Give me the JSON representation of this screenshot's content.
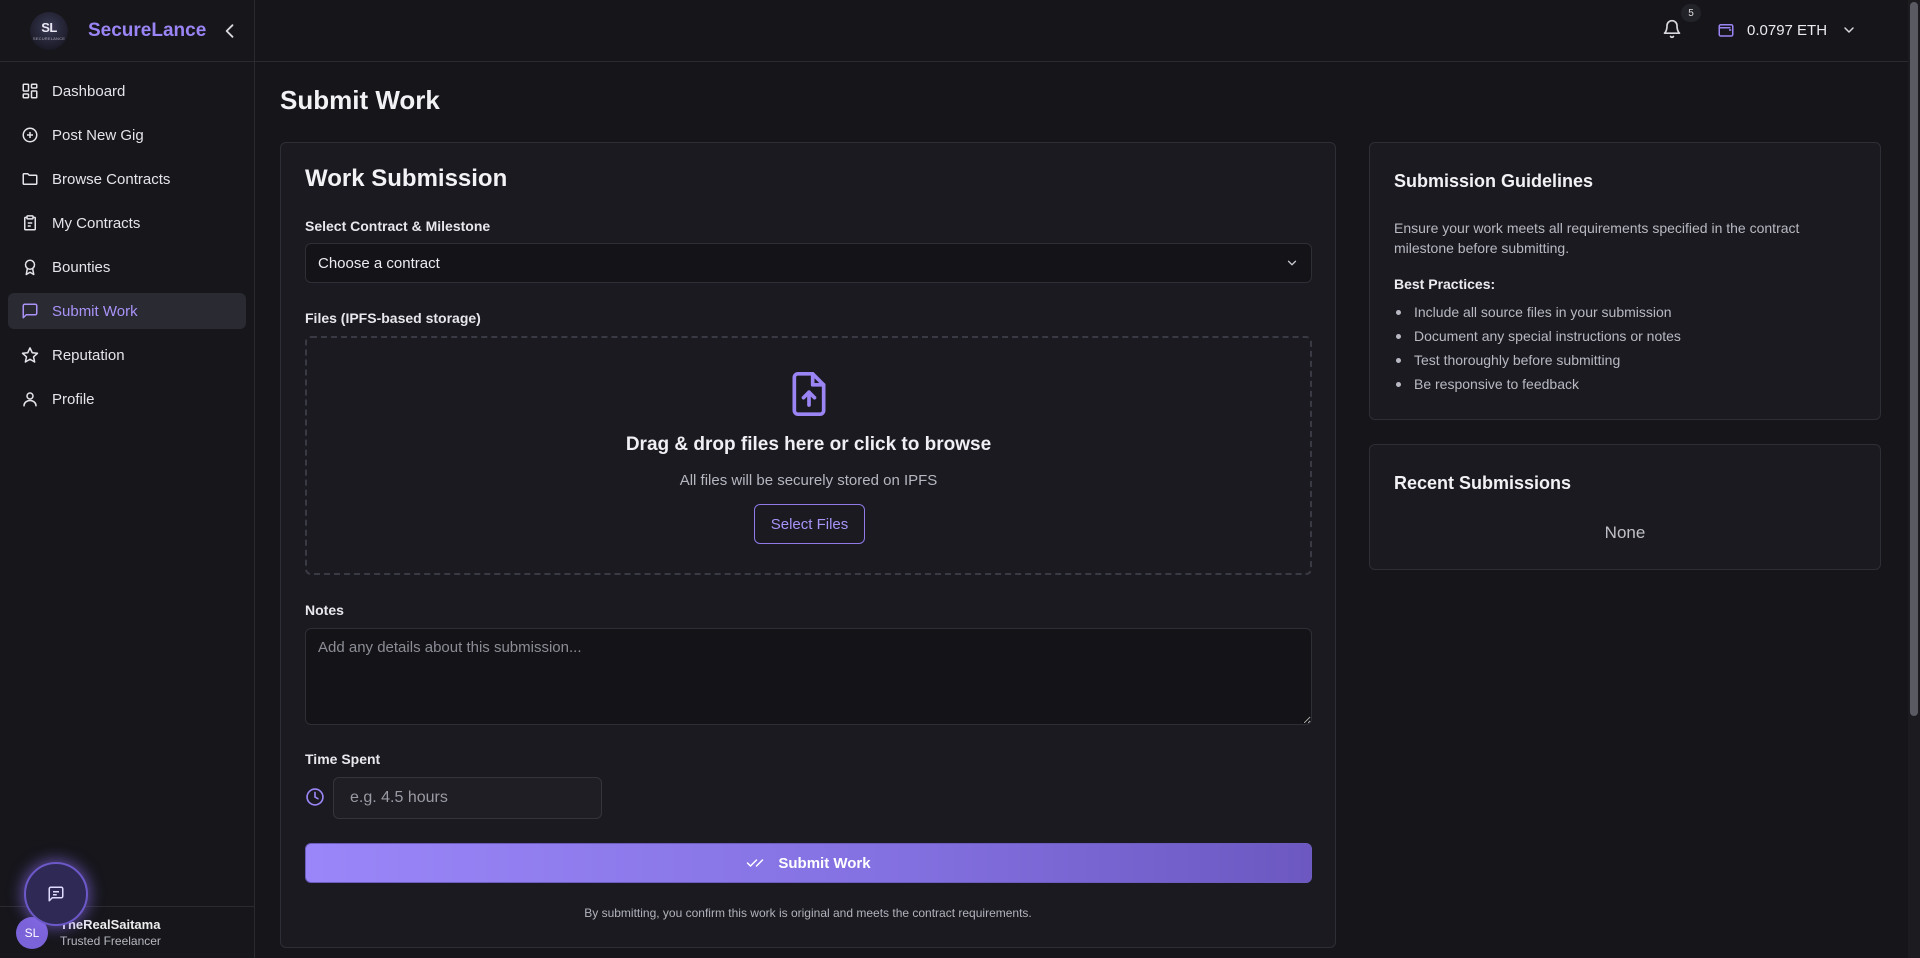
{
  "brand": {
    "logo_text": "SL",
    "logo_subtext": "SECURELANCE",
    "name": "SecureLance"
  },
  "sidebar": {
    "items": [
      {
        "label": "Dashboard",
        "icon": "dashboard-icon"
      },
      {
        "label": "Post New Gig",
        "icon": "plus-circle-icon"
      },
      {
        "label": "Browse Contracts",
        "icon": "folder-icon"
      },
      {
        "label": "My Contracts",
        "icon": "clipboard-icon"
      },
      {
        "label": "Bounties",
        "icon": "award-icon"
      },
      {
        "label": "Submit Work",
        "icon": "message-square-icon",
        "active": true
      },
      {
        "label": "Reputation",
        "icon": "star-icon"
      },
      {
        "label": "Profile",
        "icon": "user-icon"
      }
    ]
  },
  "user": {
    "initials": "SL",
    "name": "TheRealSaitama",
    "role": "Trusted Freelancer"
  },
  "header": {
    "notifications_count": "5",
    "wallet_balance": "0.0797 ETH"
  },
  "page": {
    "title": "Submit Work"
  },
  "form": {
    "title": "Work Submission",
    "contract_label": "Select Contract & Milestone",
    "contract_value": "Choose a contract",
    "files_label": "Files (IPFS-based storage)",
    "dropzone_title": "Drag & drop files here or click to browse",
    "dropzone_subtitle": "All files will be securely stored on IPFS",
    "select_files_label": "Select Files",
    "notes_label": "Notes",
    "notes_placeholder": "Add any details about this submission...",
    "time_label": "Time Spent",
    "time_placeholder": "e.g. 4.5 hours",
    "submit_label": "Submit Work",
    "disclaimer": "By submitting, you confirm this work is original and meets the contract requirements."
  },
  "guidelines": {
    "title": "Submission Guidelines",
    "intro": "Ensure your work meets all requirements specified in the contract milestone before submitting.",
    "best_practices_title": "Best Practices:",
    "items": [
      "Include all source files in your submission",
      "Document any special instructions or notes",
      "Test thoroughly before submitting",
      "Be responsive to feedback"
    ]
  },
  "recent": {
    "title": "Recent Submissions",
    "empty": "None"
  },
  "colors": {
    "accent": "#9b85f5",
    "background": "#15151a",
    "card": "#1a1a20"
  }
}
